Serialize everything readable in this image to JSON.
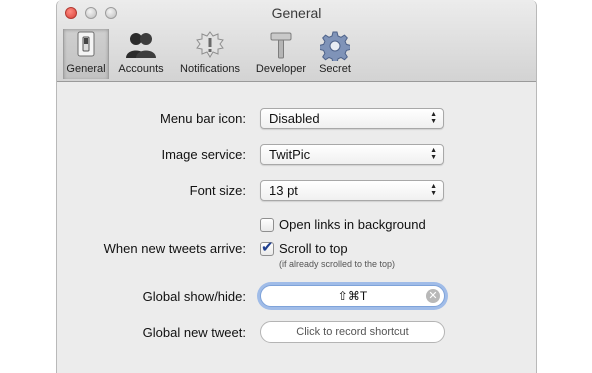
{
  "window": {
    "title": "General"
  },
  "toolbar": {
    "tabs": [
      {
        "label": "General",
        "icon": "light-switch-icon",
        "active": true
      },
      {
        "label": "Accounts",
        "icon": "people-icon",
        "active": false
      },
      {
        "label": "Notifications",
        "icon": "notification-badge-icon",
        "active": false
      },
      {
        "label": "Developer",
        "icon": "hammer-icon",
        "active": false
      },
      {
        "label": "Secret",
        "icon": "gear-icon",
        "active": false
      }
    ]
  },
  "form": {
    "menu_bar_icon": {
      "label": "Menu bar icon:",
      "value": "Disabled"
    },
    "image_service": {
      "label": "Image service:",
      "value": "TwitPic"
    },
    "font_size": {
      "label": "Font size:",
      "value": "13 pt"
    },
    "open_links": {
      "label": "Open links in background",
      "checked": false
    },
    "new_tweets": {
      "label": "When new tweets arrive:",
      "option": "Scroll to top",
      "checked": true,
      "hint": "(if already scrolled to the top)"
    },
    "global_show_hide": {
      "label": "Global show/hide:",
      "value": "⇧⌘T"
    },
    "global_new_tweet": {
      "label": "Global new tweet:",
      "placeholder": "Click to record shortcut"
    }
  },
  "colors": {
    "focus_ring": "#6295e6",
    "checkmark": "#1f3f8f",
    "close_button": "#d9423a"
  }
}
